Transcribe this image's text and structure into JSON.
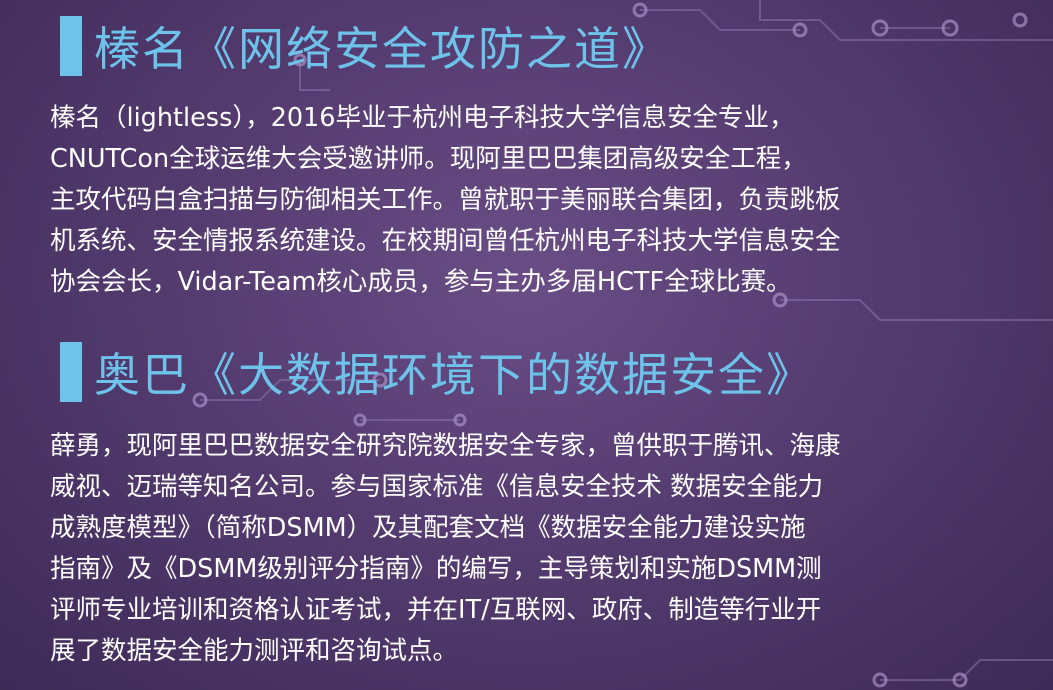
{
  "speaker1": {
    "heading": "榛名《网络安全攻防之道》",
    "bio": "榛名（lightless），2016毕业于杭州电子科技大学信息安全专业，\nCNUTCon全球运维大会受邀讲师。现阿里巴巴集团高级安全工程，\n主攻代码白盒扫描与防御相关工作。曾就职于美丽联合集团，负责跳板\n机系统、安全情报系统建设。在校期间曾任杭州电子科技大学信息安全\n协会会长，Vidar-Team核心成员，参与主办多届HCTF全球比赛。"
  },
  "speaker2": {
    "heading": "奥巴《大数据环境下的数据安全》",
    "bio": "薛勇，现阿里巴巴数据安全研究院数据安全专家，曾供职于腾讯、海康\n威视、迈瑞等知名公司。参与国家标准《信息安全技术 数据安全能力\n成熟度模型》（简称DSMM）及其配套文档《数据安全能力建设实施\n指南》及《DSMM级别评分指南》的编写，主导策划和实施DSMM测\n评师专业培训和资格认证考试，并在IT/互联网、政府、制造等行业开\n展了数据安全能力测评和咨询试点。"
  },
  "colors": {
    "accent": "#6ec3ea",
    "text": "#ffffff",
    "background": "#553c70"
  }
}
